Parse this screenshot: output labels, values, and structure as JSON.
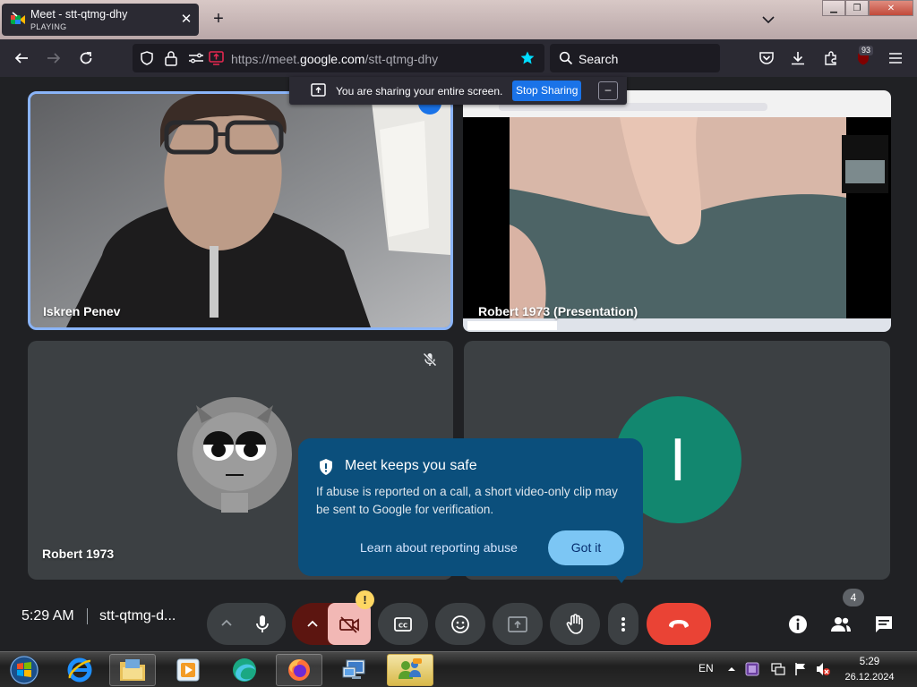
{
  "browser": {
    "tab_title": "Meet - stt-qtmg-dhy",
    "tab_status": "PLAYING",
    "url_prefix": "https://meet.",
    "url_domain": "google.com",
    "url_path": "/stt-qtmg-dhy",
    "search_label": "Search",
    "extension_badge": "93"
  },
  "share_banner": {
    "message": "You are sharing your entire screen.",
    "stop_label": "Stop Sharing",
    "hide_label": "–"
  },
  "tiles": [
    {
      "name": "Iskren Penev"
    },
    {
      "name": "Robert 1973 (Presentation)"
    },
    {
      "name": "Robert 1973"
    },
    {
      "initial": "I",
      "avatar_color": "#12876f"
    }
  ],
  "popup": {
    "title": "Meet keeps you safe",
    "body": "If abuse is reported on a call, a short video-only clip may be sent to Google for verification.",
    "learn_label": "Learn about reporting abuse",
    "got_label": "Got it"
  },
  "bottom": {
    "time": "5:29 AM",
    "meeting_code": "stt-qtmg-d...",
    "participants_count": "4",
    "camera_warning": "!"
  },
  "taskbar": {
    "language": "EN",
    "time": "5:29",
    "date": "26.12.2024"
  },
  "colors": {
    "active_tile_border": "#8ab4f8",
    "end_call": "#ea4335",
    "popup_bg": "#0b4f7c",
    "got_it_button": "#7cc6f4"
  }
}
